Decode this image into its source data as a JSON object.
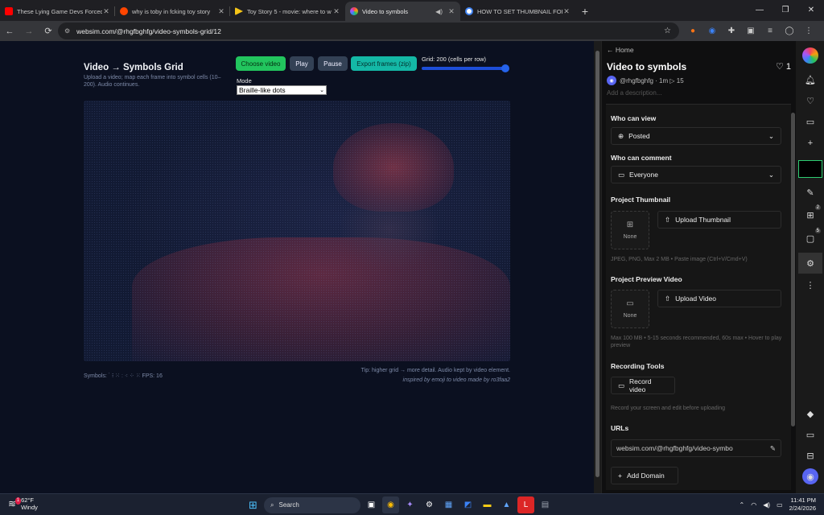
{
  "browser": {
    "tabs": [
      {
        "title": "These Lying Game Devs Forced",
        "favicon_color": "#ff0000",
        "active": false
      },
      {
        "title": "why is toby in fcking toy story",
        "favicon_color": "#ff4500",
        "active": false
      },
      {
        "title": "Toy Story 5 - movie: where to w",
        "favicon_color": "#f5c518",
        "active": false
      },
      {
        "title": "Video to symbols",
        "favicon_color": "#7c5cff",
        "active": true
      },
      {
        "title": "HOW TO SET THUMBNAIL FOR",
        "favicon_color": "#4285f4",
        "active": false
      }
    ],
    "url": "websim.com/@rhgfbghfg/video-symbols-grid/12"
  },
  "app": {
    "title": "Video → Symbols Grid",
    "subtitle": "Upload a video; map each frame into symbol cells (10–200). Audio continues.",
    "buttons": {
      "choose": "Choose video",
      "play": "Play",
      "pause": "Pause",
      "export": "Export frames (zip)"
    },
    "grid_label": "Grid: 200 (cells per row)",
    "grid_value": 200,
    "grid_max": 200,
    "mode_label": "Mode",
    "mode_value": "Braille-like dots",
    "symbols_text": "Symbols: ˙ ⁝ ⁙ ⁣ː ⁖ ⁘ ⁙ FPS: 16",
    "tip": "Tip: higher grid → more detail. Audio kept by video element.",
    "credit": "inspired by emoji to video made by ro3faa2"
  },
  "panel": {
    "home": "Home",
    "title": "Video to symbols",
    "likes": "1",
    "user": "@rhgfbghfg",
    "meta": "· 1m ▷ 15",
    "description_placeholder": "Add a description...",
    "who_can_view": {
      "label": "Who can view",
      "value": "Posted"
    },
    "who_can_comment": {
      "label": "Who can comment",
      "value": "Everyone"
    },
    "thumbnail": {
      "label": "Project Thumbnail",
      "none": "None",
      "upload": "Upload Thumbnail",
      "hint": "JPEG, PNG, Max 2 MB • Paste image (Ctrl+V/Cmd+V)"
    },
    "preview_video": {
      "label": "Project Preview Video",
      "none": "None",
      "upload": "Upload Video",
      "hint": "Max 100 MB • 5-15 seconds recommended, 60s max • Hover to play preview"
    },
    "recording": {
      "label": "Recording Tools",
      "button": "Record video",
      "hint": "Record your screen and edit before uploading"
    },
    "urls": {
      "label": "URLs",
      "value": "websim.com/@rhgfbghfg/video-symbo",
      "add_domain": "Add Domain"
    }
  },
  "rail": {
    "badge_apps": "2",
    "badge_chat": "5"
  },
  "taskbar": {
    "temp": "62°F",
    "weather": "Windy",
    "weather_badge": "1",
    "search": "Search",
    "time": "11:41 PM",
    "date": "2/24/2026"
  }
}
